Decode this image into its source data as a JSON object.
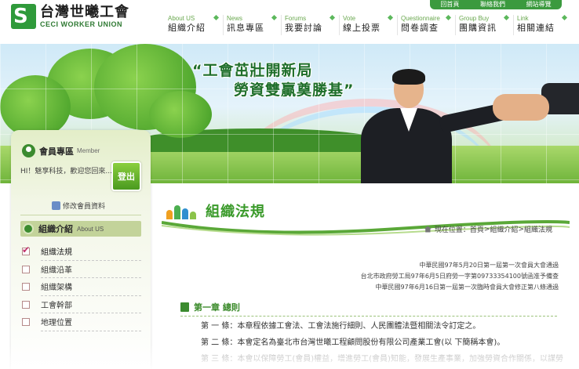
{
  "header": {
    "logo": {
      "mark": "S",
      "name_cn": "台灣世曦工會",
      "name_en": "CECI WORKER UNION"
    },
    "top_links": [
      "回首頁",
      "聯絡我們",
      "網站導覽"
    ],
    "nav": [
      {
        "en": "About US",
        "cn": "組織介紹"
      },
      {
        "en": "News",
        "cn": "訊息專區"
      },
      {
        "en": "Forums",
        "cn": "我要討論"
      },
      {
        "en": "Vote",
        "cn": "線上投票"
      },
      {
        "en": "Questionnaire",
        "cn": "問卷調查"
      },
      {
        "en": "Group Buy",
        "cn": "團購資訊"
      },
      {
        "en": "Link",
        "cn": "相關連結"
      }
    ]
  },
  "banner": {
    "slogan_line1": "“工會茁壯開新局",
    "slogan_line2": "勞資雙贏奠勝基”"
  },
  "sidebar": {
    "member": {
      "title_cn": "會員專區",
      "title_en": "Member",
      "greeting": "HI！魅享科技，歡迎您回來....",
      "logout_label": "登出",
      "edit_label": "修改會員資料"
    },
    "section": {
      "title_cn": "組織介紹",
      "title_en": "About US"
    },
    "menu": [
      {
        "label": "組織法規",
        "active": true
      },
      {
        "label": "組織沿革",
        "active": false
      },
      {
        "label": "組織架構",
        "active": false
      },
      {
        "label": "工會幹部",
        "active": false
      },
      {
        "label": "地理位置",
        "active": false
      }
    ]
  },
  "main": {
    "page_title": "組織法規",
    "breadcrumb": {
      "prefix": "現在位置：",
      "items": [
        "首頁",
        "組織介紹",
        "組織法規"
      ],
      "separator": " > "
    },
    "notes": [
      "中華民國97年5月20日第一屆第一次會員大會通過",
      "台北市政府勞工局97年6月5日府勞一字第09733354100號函准予備查",
      "中華民國97年6月16日第一屆第一次臨時會員大會修正第八條通過"
    ],
    "chapter": "第一章 總則",
    "articles": [
      "第 一 條：本章程依據工會法、工會法施行細則、人民團體法暨相關法令訂定之。",
      "第 二 條：本會定名為臺北市台灣世曦工程顧問股份有限公司產業工會(以 下簡稱本會)。",
      "第 三 條：本會以保障勞工(會員)權益，增進勞工(會員)知能，發展生產事業，加強勞資合作關係，以謀勞"
    ]
  },
  "colors": {
    "brand_green": "#3a9a2a",
    "dark_green": "#2f7a33",
    "sidebar_section": "#c3d39a",
    "logout_button": "#4a9a1f"
  }
}
